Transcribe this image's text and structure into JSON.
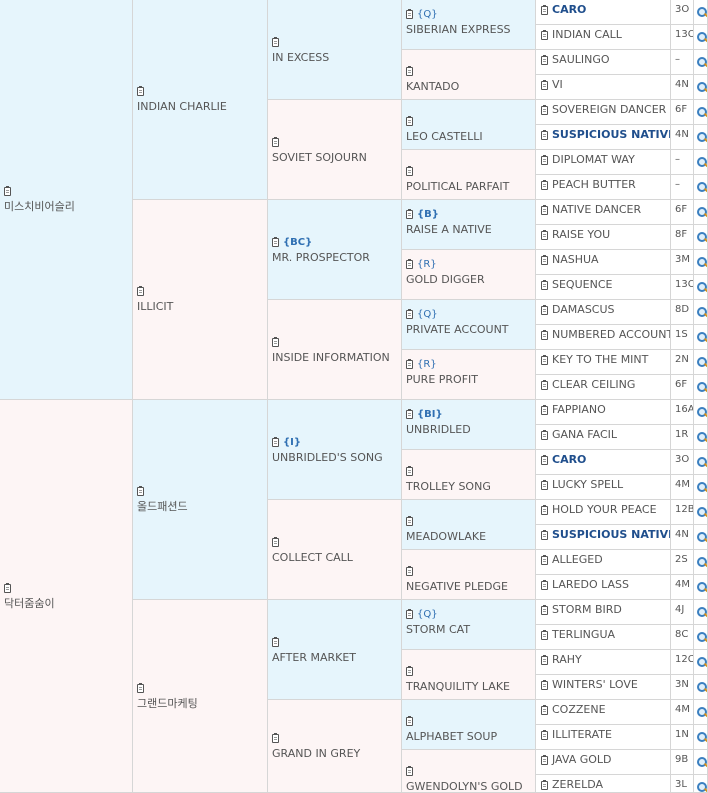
{
  "generation1": [
    {
      "name": "미스치비어슬리"
    },
    {
      "name": "닥터줌숨이"
    }
  ],
  "generation2": [
    {
      "name": "INDIAN CHARLIE"
    },
    {
      "name": "ILLICIT"
    },
    {
      "name": "올드패션드"
    },
    {
      "name": "그랜드마케팅"
    }
  ],
  "generation3": [
    {
      "tag": "",
      "name": "IN EXCESS"
    },
    {
      "tag": "",
      "name": "SOVIET SOJOURN"
    },
    {
      "tag": "{BC}",
      "name": "MR. PROSPECTOR"
    },
    {
      "tag": "",
      "name": "INSIDE INFORMATION"
    },
    {
      "tag": "{I}",
      "name": "UNBRIDLED'S SONG"
    },
    {
      "tag": "",
      "name": "COLLECT CALL"
    },
    {
      "tag": "",
      "name": "AFTER MARKET"
    },
    {
      "tag": "",
      "name": "GRAND IN GREY"
    }
  ],
  "generation4": [
    {
      "tag": "{Q}",
      "name": "SIBERIAN EXPRESS"
    },
    {
      "tag": "",
      "name": "KANTADO"
    },
    {
      "tag": "",
      "name": "LEO CASTELLI"
    },
    {
      "tag": "",
      "name": "POLITICAL PARFAIT"
    },
    {
      "tag": "{B}",
      "name": "RAISE A NATIVE"
    },
    {
      "tag": "{R}",
      "name": "GOLD DIGGER"
    },
    {
      "tag": "{Q}",
      "name": "PRIVATE ACCOUNT"
    },
    {
      "tag": "{R}",
      "name": "PURE PROFIT"
    },
    {
      "tag": "{BI}",
      "name": "UNBRIDLED"
    },
    {
      "tag": "",
      "name": "TROLLEY SONG"
    },
    {
      "tag": "",
      "name": "MEADOWLAKE"
    },
    {
      "tag": "",
      "name": "NEGATIVE PLEDGE"
    },
    {
      "tag": "{Q}",
      "name": "STORM CAT"
    },
    {
      "tag": "",
      "name": "TRANQUILITY LAKE"
    },
    {
      "tag": "",
      "name": "ALPHABET SOUP"
    },
    {
      "tag": "",
      "name": "GWENDOLYN'S GOLD"
    }
  ],
  "generation5": [
    {
      "name": "CARO",
      "code": "3O"
    },
    {
      "name": "INDIAN CALL",
      "code": "13O"
    },
    {
      "name": "SAULINGO",
      "code": "–"
    },
    {
      "name": "VI",
      "code": "4N"
    },
    {
      "name": "SOVEREIGN DANCER",
      "code": "6F"
    },
    {
      "name": "SUSPICIOUS NATIVE",
      "code": "4N"
    },
    {
      "name": "DIPLOMAT WAY",
      "code": "–"
    },
    {
      "name": "PEACH BUTTER",
      "code": "–"
    },
    {
      "name": "NATIVE DANCER",
      "code": "6F"
    },
    {
      "name": "RAISE YOU",
      "code": "8F"
    },
    {
      "name": "NASHUA",
      "code": "3M"
    },
    {
      "name": "SEQUENCE",
      "code": "13O"
    },
    {
      "name": "DAMASCUS",
      "code": "8D"
    },
    {
      "name": "NUMBERED ACCOUNT",
      "code": "1S"
    },
    {
      "name": "KEY TO THE MINT",
      "code": "2N"
    },
    {
      "name": "CLEAR CEILING",
      "code": "6F"
    },
    {
      "name": "FAPPIANO",
      "code": "16A"
    },
    {
      "name": "GANA FACIL",
      "code": "1R"
    },
    {
      "name": "CARO",
      "code": "3O"
    },
    {
      "name": "LUCKY SPELL",
      "code": "4M"
    },
    {
      "name": "HOLD YOUR PEACE",
      "code": "12B"
    },
    {
      "name": "SUSPICIOUS NATIVE",
      "code": "4N"
    },
    {
      "name": "ALLEGED",
      "code": "2S"
    },
    {
      "name": "LAREDO LASS",
      "code": "4M"
    },
    {
      "name": "STORM BIRD",
      "code": "4J"
    },
    {
      "name": "TERLINGUA",
      "code": "8C"
    },
    {
      "name": "RAHY",
      "code": "12C"
    },
    {
      "name": "WINTERS' LOVE",
      "code": "3N"
    },
    {
      "name": "COZZENE",
      "code": "4M"
    },
    {
      "name": "ILLITERATE",
      "code": "1N"
    },
    {
      "name": "JAVA GOLD",
      "code": "9B"
    },
    {
      "name": "ZERELDA",
      "code": "3L"
    }
  ],
  "colors": {
    "sire_bg": "#e6f5fc",
    "dam_bg": "#fdf5f5",
    "highlight_text": "#1f4e8c",
    "tag_text": "#2f6fb2"
  },
  "icons": {
    "document": "clipboard-icon",
    "search": "search-icon"
  }
}
